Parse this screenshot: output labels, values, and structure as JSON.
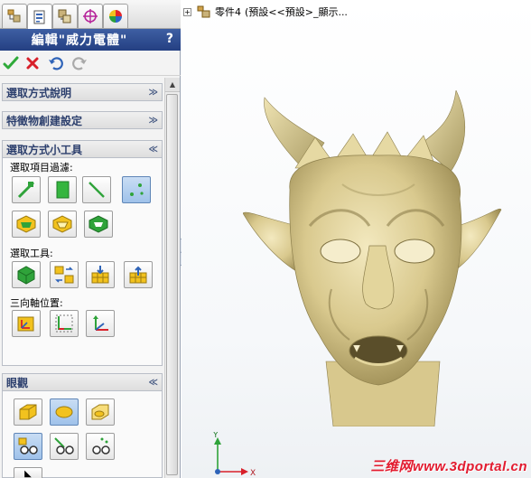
{
  "pm_tabs": [
    {
      "name": "feature-manager-tab",
      "icon": "feature-tree-icon",
      "active": false
    },
    {
      "name": "property-manager-tab",
      "icon": "property-manager-icon",
      "active": true
    },
    {
      "name": "configuration-manager-tab",
      "icon": "configuration-manager-icon",
      "active": false
    },
    {
      "name": "dimxpert-tab",
      "icon": "target-crosshair-icon",
      "active": false
    },
    {
      "name": "display-manager-tab",
      "icon": "color-wheel-icon",
      "active": false
    }
  ],
  "property_manager": {
    "title": "編輯\"威力電體\"",
    "help": "?"
  },
  "actions": {
    "ok_icon": "green-check-icon",
    "cancel_icon": "red-x-icon",
    "undo_icon": "undo-icon",
    "redo_icon": "redo-icon"
  },
  "groups": {
    "selection_method_desc": {
      "label": "選取方式說明",
      "chevron": "≫"
    },
    "feature_creation": {
      "label": "特徵物創建設定",
      "chevron": "≫"
    },
    "selection_tools_group": {
      "label": "選取方式小工具",
      "chevron": "≪",
      "filter_label": "選取項目過濾:",
      "tools_label": "選取工具:",
      "triad_label": "三向軸位置:"
    },
    "view": {
      "label": "眼觀",
      "chevron": "≪"
    }
  },
  "tree": {
    "expander": "+",
    "part_label": "零件4",
    "config_label": "(預設<<預設>_顯示..."
  },
  "triad_axes": {
    "x": "X",
    "y": "Y"
  },
  "watermark": "三维网www.3dportal.cn",
  "colors": {
    "title_bar": "#2c478e",
    "model": "#d9c98e",
    "accent_green": "#2faa3a",
    "accent_red": "#d8202a"
  }
}
